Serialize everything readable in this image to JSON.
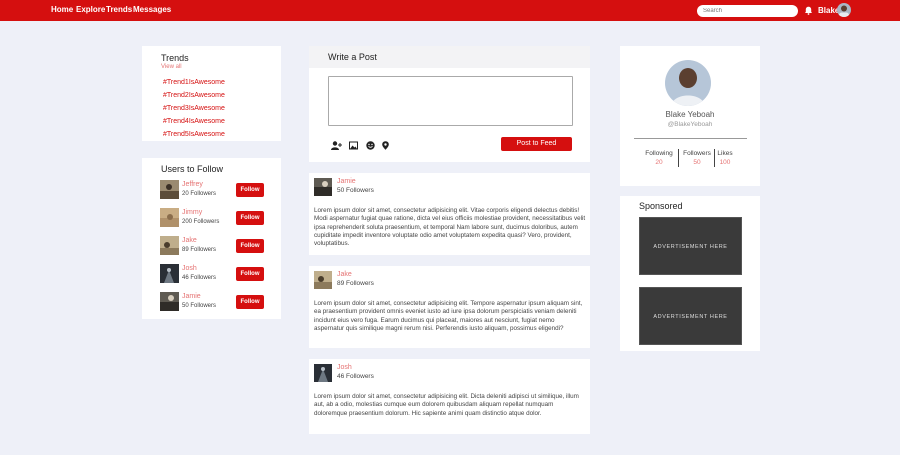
{
  "nav": {
    "links": [
      "Home",
      "Explore",
      "Trends",
      "Messages"
    ],
    "search_placeholder": "Search",
    "user_name": "Blake",
    "brand_color": "#d50f0f"
  },
  "trends": {
    "title": "Trends",
    "view_all": "View all",
    "items": [
      "#Trend1IsAwesome",
      "#Trend2IsAwesome",
      "#Trend3IsAwesome",
      "#Trend4IsAwesome",
      "#Trend5IsAwesome"
    ]
  },
  "users_to_follow": {
    "title": "Users to Follow",
    "follow_label": "Follow",
    "users": [
      {
        "name": "Jeffrey",
        "followers": "20 Followers"
      },
      {
        "name": "Jimmy",
        "followers": "200 Followers"
      },
      {
        "name": "Jake",
        "followers": "89 Followers"
      },
      {
        "name": "Josh",
        "followers": "46 Followers"
      },
      {
        "name": "Jamie",
        "followers": "50 Followers"
      }
    ]
  },
  "write_post": {
    "title": "Write a Post",
    "button": "Post to Feed",
    "icons": [
      "add-user-icon",
      "image-icon",
      "emoji-icon",
      "location-icon"
    ]
  },
  "posts": [
    {
      "name": "Jamie",
      "followers": "50 Followers",
      "body": "Lorem ipsum dolor sit amet, consectetur adipisicing elit. Vitae corporis eligendi delectus debitis! Modi aspernatur fugiat quae ratione, dicta vel eius officiis molestiae provident, necessitatibus velit ipsa reprehenderit soluta praesentium, et temporal Nam labore sunt, ducimus doloribus, autem cupiditate impedit inventore voluptate odio amet voluptatem expedita quasi? Vero, provident, voluptatibus."
    },
    {
      "name": "Jake",
      "followers": "89 Followers",
      "body": "Lorem ipsum dolor sit amet, consectetur adipisicing elit. Tempore aspernatur ipsum aliquam sint, ea praesentium provident omnis eveniet iusto ad iure ipsa dolorum perspiciatis veniam deleniti incidunt eius vero fuga. Earum ducimus qui placeat, maiores aut nesciunt, fugiat nemo aspernatur quis similique magni rerum nisi. Perferendis iusto aliquam, possimus eligendi?"
    },
    {
      "name": "Josh",
      "followers": "46 Followers",
      "body": "Lorem ipsum dolor sit amet, consectetur adipisicing elit. Dicta deleniti adipisci ut similique, illum aut, ab a odio, molestias cumque eum dolorem quibusdam aliquam repellat numquam doloremque praesentium dolorum. Hic sapiente animi quam distinctio atque dolor."
    }
  ],
  "profile": {
    "name": "Blake Yeboah",
    "handle": "@BlakeYeboah",
    "stats": [
      {
        "label": "Following",
        "value": "20"
      },
      {
        "label": "Followers",
        "value": "50"
      },
      {
        "label": "Likes",
        "value": "100"
      }
    ]
  },
  "sponsored": {
    "title": "Sponsored",
    "ads": [
      "ADVERTISEMENT HERE",
      "ADVERTISEMENT HERE"
    ]
  }
}
